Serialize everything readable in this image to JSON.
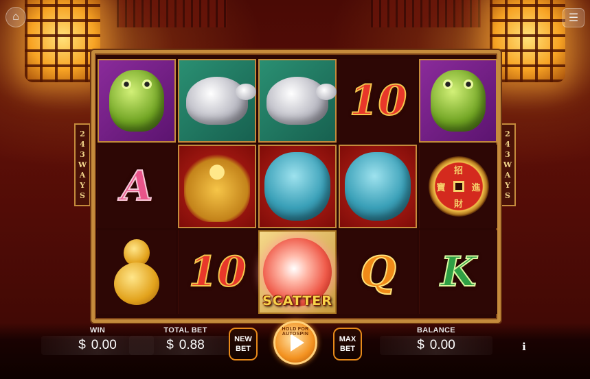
{
  "game": {
    "ways_label": [
      "2",
      "4",
      "3",
      "W",
      "A",
      "Y",
      "S"
    ]
  },
  "reels": [
    [
      {
        "symbol": "toad-icon",
        "bg": "purple"
      },
      {
        "symbol": "letter",
        "text": "A",
        "color": "pink"
      },
      {
        "symbol": "gourd-icon",
        "bg": "none"
      }
    ],
    [
      {
        "symbol": "turtle-icon",
        "bg": "teal"
      },
      {
        "symbol": "dragon-icon",
        "bg": "red"
      },
      {
        "symbol": "letter",
        "text": "10",
        "color": "red"
      }
    ],
    [
      {
        "symbol": "turtle-icon",
        "bg": "teal"
      },
      {
        "symbol": "lion-icon",
        "bg": "red"
      },
      {
        "symbol": "scatter-orb",
        "bg": "gold",
        "text": "SCATTER"
      }
    ],
    [
      {
        "symbol": "letter",
        "text": "10",
        "color": "red"
      },
      {
        "symbol": "lion-icon",
        "bg": "red"
      },
      {
        "symbol": "letter",
        "text": "Q",
        "color": "orange"
      }
    ],
    [
      {
        "symbol": "toad-icon",
        "bg": "purple"
      },
      {
        "symbol": "coin-icon",
        "bg": "none",
        "chars": [
          "招",
          "進",
          "財",
          "寶"
        ]
      },
      {
        "symbol": "letter",
        "text": "K",
        "color": "green"
      }
    ]
  ],
  "controls": {
    "win_label": "WIN",
    "win_currency": "$",
    "win_value": "0.00",
    "total_bet_label": "TOTAL BET",
    "total_bet_currency": "$",
    "total_bet_value": "0.88",
    "new_bet_label": "NEW BET",
    "spin_hint": "HOLD FOR AUTOSPIN",
    "max_bet_label": "MAX BET",
    "balance_label": "BALANCE",
    "balance_currency": "$",
    "balance_value": "0.00",
    "info_label": "i"
  },
  "icons": {
    "home": "home-icon",
    "menu": "menu-icon",
    "spin": "play-icon"
  },
  "colors": {
    "frame": "#c58b3c",
    "accent": "#f39220"
  }
}
